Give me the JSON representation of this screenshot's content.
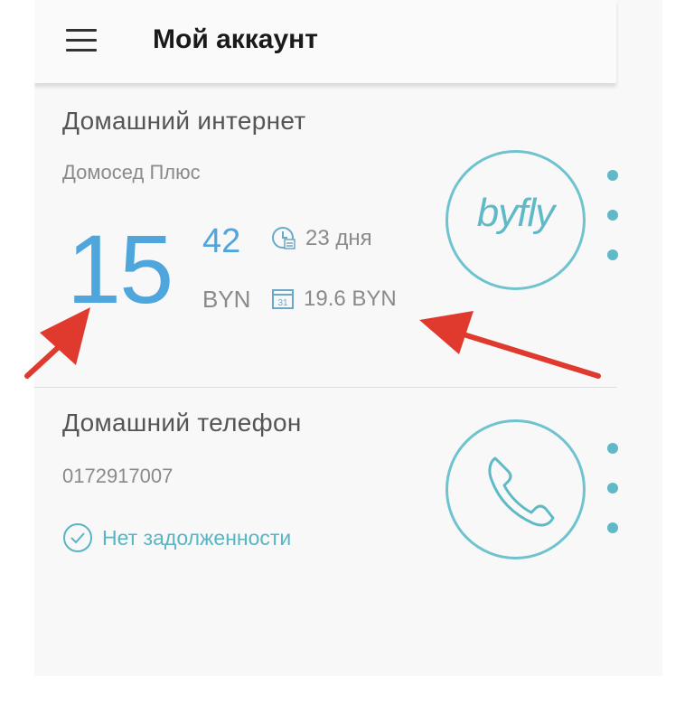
{
  "header": {
    "title": "Мой аккаунт",
    "menu_icon": "hamburger-menu-icon"
  },
  "services": {
    "internet": {
      "title": "Домашний интернет",
      "plan": "Домосед Плюс",
      "balance_integer": "15",
      "balance_fraction": "42",
      "currency": "BYN",
      "days_left": "23 дня",
      "monthly_fee": "19.6 BYN",
      "logo_text": "byfly"
    },
    "phone": {
      "title": "Домашний телефон",
      "number": "0172917007",
      "status": "Нет задолженности"
    }
  },
  "colors": {
    "accent": "#4fa6dd",
    "teal": "#5fb9c7",
    "arrow": "#e03a2f"
  }
}
